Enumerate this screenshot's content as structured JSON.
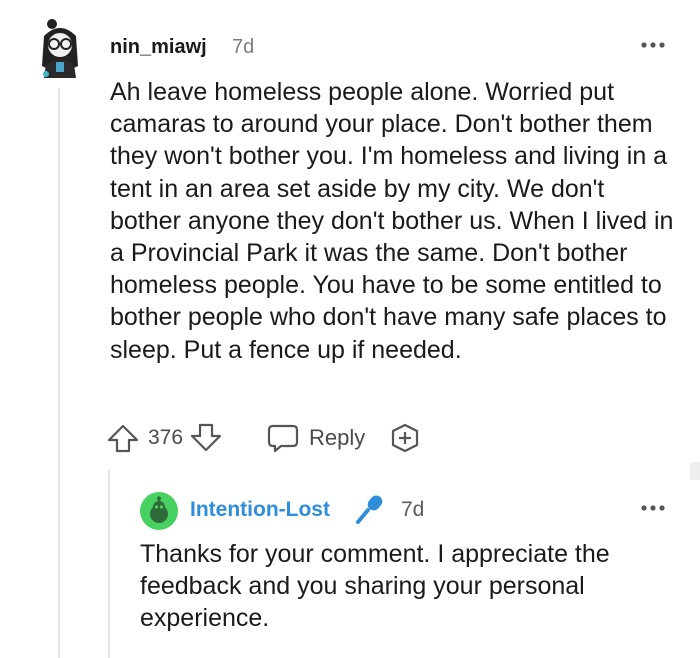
{
  "comment": {
    "username": "nin_miawj",
    "age": "7d",
    "body": "Ah leave homeless people alone. Worried put camaras to around your place. Don't bother them they won't bother you. I'm homeless and living in a tent in an area set aside by my city. We don't bother anyone they don't bother us. When I lived in a Provincial Park it was the same. Don't bother homeless people. You have to be some entitled to bother people who don't have many safe places to sleep. Put a fence up if needed.",
    "score": "376",
    "reply_label": "Reply",
    "icons": [
      "avatar",
      "more-options-icon",
      "upvote-icon",
      "downvote-icon",
      "reply-icon",
      "award-icon"
    ]
  },
  "reply": {
    "username": "Intention-Lost",
    "age": "7d",
    "body": "Thanks for your comment. I appreciate the feedback and you sharing your personal experience.",
    "icons": [
      "avatar",
      "microphone-icon",
      "more-options-icon"
    ],
    "username_color": "#2f8ed9"
  },
  "colors": {
    "text": "#1a1a1b",
    "meta": "#7c7c7c",
    "thread_line": "#e5e5e5",
    "avatar_green": "#46d160"
  }
}
